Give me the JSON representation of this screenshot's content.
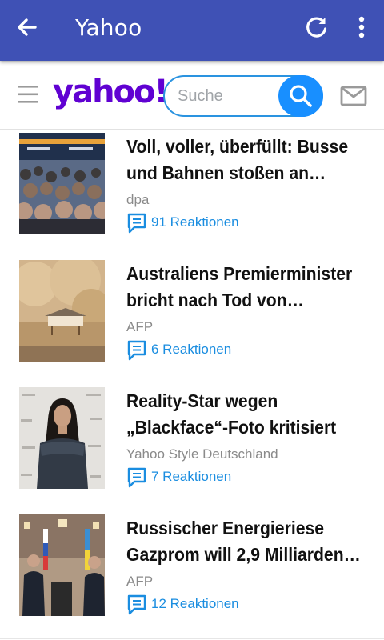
{
  "app_bar": {
    "title": "Yahoo",
    "back_icon": "arrow-left-icon",
    "refresh_icon": "refresh-icon",
    "more_icon": "more-vert-icon",
    "color": "#3f51b5"
  },
  "yahoo_header": {
    "menu_icon": "hamburger-icon",
    "logo": "yahoo!",
    "logo_color": "#6001d2",
    "search_placeholder": "Suche",
    "search_icon": "search-icon",
    "mail_icon": "mail-icon"
  },
  "articles": [
    {
      "title": "Voll, voller, überfüllt: Busse und Bahnen stoßen an…",
      "source": "dpa",
      "reactions": "91 Reaktionen"
    },
    {
      "title": "Australiens Premierminister bricht nach Tod von…",
      "source": "AFP",
      "reactions": "6 Reaktionen"
    },
    {
      "title": "Reality-Star wegen „Blackface“-Foto kritisiert",
      "source": "Yahoo Style Deutschland",
      "reactions": "7 Reaktionen"
    },
    {
      "title": "Russischer Energieriese Gazprom will 2,9 Milliarden…",
      "source": "AFP",
      "reactions": "12 Reaktionen"
    }
  ],
  "accent_color": "#188fff"
}
